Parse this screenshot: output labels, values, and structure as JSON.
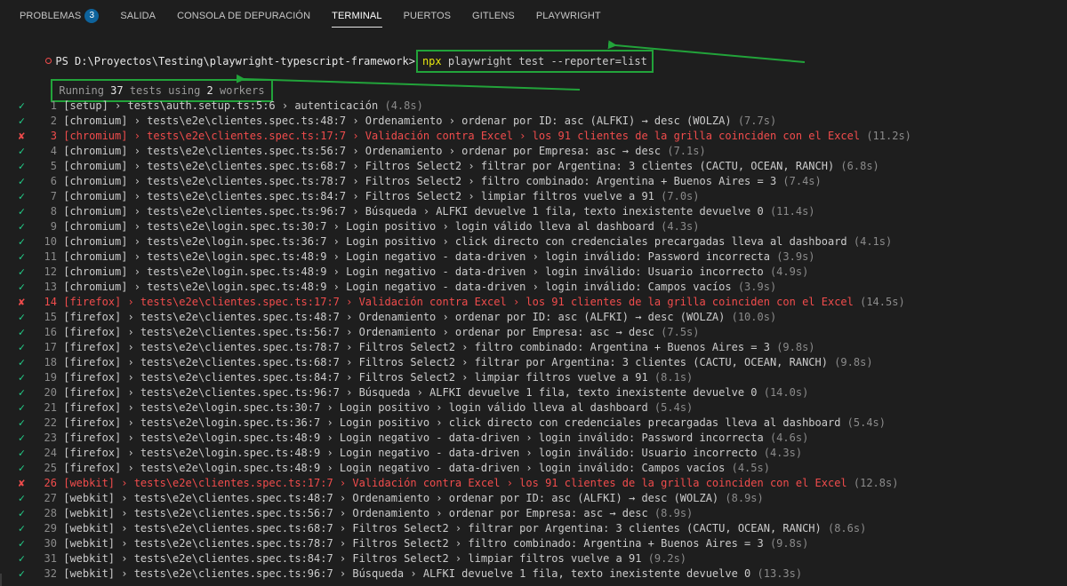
{
  "tabs": [
    {
      "label": "PROBLEMAS",
      "badge": "3"
    },
    {
      "label": "SALIDA"
    },
    {
      "label": "CONSOLA DE DEPURACIÓN"
    },
    {
      "label": "TERMINAL",
      "active": true
    },
    {
      "label": "PUERTOS"
    },
    {
      "label": "GITLENS"
    },
    {
      "label": "PLAYWRIGHT"
    }
  ],
  "prompt": {
    "prefix": "PS D:\\Proyectos\\Testing\\playwright-typescript-framework>",
    "npx": "npx",
    "command": " playwright test --reporter=list"
  },
  "summary": {
    "pre": "Running ",
    "tests": "37",
    "mid": " tests using ",
    "workers": "2",
    "post": " workers"
  },
  "colors": {
    "pass": "#23d18b",
    "fail": "#f14c4c",
    "highlight_box": "#22a33a",
    "npx": "#e5e510"
  },
  "results": [
    {
      "status": "pass",
      "n": "1",
      "text": "[setup] › tests\\auth.setup.ts:5:6 › autenticación",
      "duration": "(4.8s)"
    },
    {
      "status": "pass",
      "n": "2",
      "text": "[chromium] › tests\\e2e\\clientes.spec.ts:48:7 › Ordenamiento › ordenar por ID: asc (ALFKI) → desc (WOLZA)",
      "duration": "(7.7s)"
    },
    {
      "status": "fail",
      "n": "3",
      "text": "[chromium] › tests\\e2e\\clientes.spec.ts:17:7 › Validación contra Excel › los 91 clientes de la grilla coinciden con el Excel",
      "duration": "(11.2s)"
    },
    {
      "status": "pass",
      "n": "4",
      "text": "[chromium] › tests\\e2e\\clientes.spec.ts:56:7 › Ordenamiento › ordenar por Empresa: asc → desc",
      "duration": "(7.1s)"
    },
    {
      "status": "pass",
      "n": "5",
      "text": "[chromium] › tests\\e2e\\clientes.spec.ts:68:7 › Filtros Select2 › filtrar por Argentina: 3 clientes (CACTU, OCEAN, RANCH)",
      "duration": "(6.8s)"
    },
    {
      "status": "pass",
      "n": "6",
      "text": "[chromium] › tests\\e2e\\clientes.spec.ts:78:7 › Filtros Select2 › filtro combinado: Argentina + Buenos Aires = 3",
      "duration": "(7.4s)"
    },
    {
      "status": "pass",
      "n": "7",
      "text": "[chromium] › tests\\e2e\\clientes.spec.ts:84:7 › Filtros Select2 › limpiar filtros vuelve a 91",
      "duration": "(7.0s)"
    },
    {
      "status": "pass",
      "n": "8",
      "text": "[chromium] › tests\\e2e\\clientes.spec.ts:96:7 › Búsqueda › ALFKI devuelve 1 fila, texto inexistente devuelve 0",
      "duration": "(11.4s)"
    },
    {
      "status": "pass",
      "n": "9",
      "text": "[chromium] › tests\\e2e\\login.spec.ts:30:7 › Login positivo › login válido lleva al dashboard",
      "duration": "(4.3s)"
    },
    {
      "status": "pass",
      "n": "10",
      "text": "[chromium] › tests\\e2e\\login.spec.ts:36:7 › Login positivo › click directo con credenciales precargadas lleva al dashboard",
      "duration": "(4.1s)"
    },
    {
      "status": "pass",
      "n": "11",
      "text": "[chromium] › tests\\e2e\\login.spec.ts:48:9 › Login negativo - data-driven › login inválido: Password incorrecta",
      "duration": "(3.9s)"
    },
    {
      "status": "pass",
      "n": "12",
      "text": "[chromium] › tests\\e2e\\login.spec.ts:48:9 › Login negativo - data-driven › login inválido: Usuario incorrecto",
      "duration": "(4.9s)"
    },
    {
      "status": "pass",
      "n": "13",
      "text": "[chromium] › tests\\e2e\\login.spec.ts:48:9 › Login negativo - data-driven › login inválido: Campos vacíos",
      "duration": "(3.9s)"
    },
    {
      "status": "fail",
      "n": "14",
      "text": "[firefox] › tests\\e2e\\clientes.spec.ts:17:7 › Validación contra Excel › los 91 clientes de la grilla coinciden con el Excel",
      "duration": "(14.5s)"
    },
    {
      "status": "pass",
      "n": "15",
      "text": "[firefox] › tests\\e2e\\clientes.spec.ts:48:7 › Ordenamiento › ordenar por ID: asc (ALFKI) → desc (WOLZA)",
      "duration": "(10.0s)"
    },
    {
      "status": "pass",
      "n": "16",
      "text": "[firefox] › tests\\e2e\\clientes.spec.ts:56:7 › Ordenamiento › ordenar por Empresa: asc → desc",
      "duration": "(7.5s)"
    },
    {
      "status": "pass",
      "n": "17",
      "text": "[firefox] › tests\\e2e\\clientes.spec.ts:78:7 › Filtros Select2 › filtro combinado: Argentina + Buenos Aires = 3",
      "duration": "(9.8s)"
    },
    {
      "status": "pass",
      "n": "18",
      "text": "[firefox] › tests\\e2e\\clientes.spec.ts:68:7 › Filtros Select2 › filtrar por Argentina: 3 clientes (CACTU, OCEAN, RANCH)",
      "duration": "(9.8s)"
    },
    {
      "status": "pass",
      "n": "19",
      "text": "[firefox] › tests\\e2e\\clientes.spec.ts:84:7 › Filtros Select2 › limpiar filtros vuelve a 91",
      "duration": "(8.1s)"
    },
    {
      "status": "pass",
      "n": "20",
      "text": "[firefox] › tests\\e2e\\clientes.spec.ts:96:7 › Búsqueda › ALFKI devuelve 1 fila, texto inexistente devuelve 0",
      "duration": "(14.0s)"
    },
    {
      "status": "pass",
      "n": "21",
      "text": "[firefox] › tests\\e2e\\login.spec.ts:30:7 › Login positivo › login válido lleva al dashboard",
      "duration": "(5.4s)"
    },
    {
      "status": "pass",
      "n": "22",
      "text": "[firefox] › tests\\e2e\\login.spec.ts:36:7 › Login positivo › click directo con credenciales precargadas lleva al dashboard",
      "duration": "(5.4s)"
    },
    {
      "status": "pass",
      "n": "23",
      "text": "[firefox] › tests\\e2e\\login.spec.ts:48:9 › Login negativo - data-driven › login inválido: Password incorrecta",
      "duration": "(4.6s)"
    },
    {
      "status": "pass",
      "n": "24",
      "text": "[firefox] › tests\\e2e\\login.spec.ts:48:9 › Login negativo - data-driven › login inválido: Usuario incorrecto",
      "duration": "(4.3s)"
    },
    {
      "status": "pass",
      "n": "25",
      "text": "[firefox] › tests\\e2e\\login.spec.ts:48:9 › Login negativo - data-driven › login inválido: Campos vacíos",
      "duration": "(4.5s)"
    },
    {
      "status": "fail",
      "n": "26",
      "text": "[webkit] › tests\\e2e\\clientes.spec.ts:17:7 › Validación contra Excel › los 91 clientes de la grilla coinciden con el Excel",
      "duration": "(12.8s)"
    },
    {
      "status": "pass",
      "n": "27",
      "text": "[webkit] › tests\\e2e\\clientes.spec.ts:48:7 › Ordenamiento › ordenar por ID: asc (ALFKI) → desc (WOLZA)",
      "duration": "(8.9s)"
    },
    {
      "status": "pass",
      "n": "28",
      "text": "[webkit] › tests\\e2e\\clientes.spec.ts:56:7 › Ordenamiento › ordenar por Empresa: asc → desc",
      "duration": "(8.9s)"
    },
    {
      "status": "pass",
      "n": "29",
      "text": "[webkit] › tests\\e2e\\clientes.spec.ts:68:7 › Filtros Select2 › filtrar por Argentina: 3 clientes (CACTU, OCEAN, RANCH)",
      "duration": "(8.6s)"
    },
    {
      "status": "pass",
      "n": "30",
      "text": "[webkit] › tests\\e2e\\clientes.spec.ts:78:7 › Filtros Select2 › filtro combinado: Argentina + Buenos Aires = 3",
      "duration": "(9.8s)"
    },
    {
      "status": "pass",
      "n": "31",
      "text": "[webkit] › tests\\e2e\\clientes.spec.ts:84:7 › Filtros Select2 › limpiar filtros vuelve a 91",
      "duration": "(9.2s)"
    },
    {
      "status": "pass",
      "n": "32",
      "text": "[webkit] › tests\\e2e\\clientes.spec.ts:96:7 › Búsqueda › ALFKI devuelve 1 fila, texto inexistente devuelve 0",
      "duration": "(13.3s)"
    }
  ]
}
